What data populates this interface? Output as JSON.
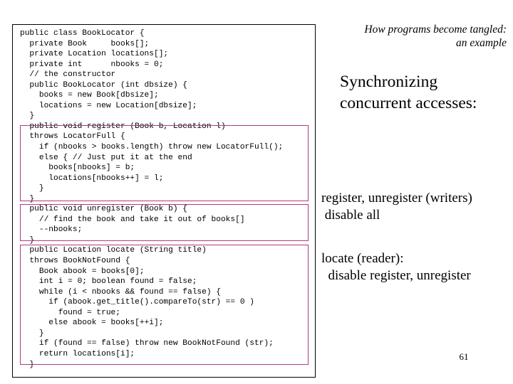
{
  "slide": {
    "title_lines": [
      "How programs become tangled:",
      "an example"
    ],
    "headline_lines": [
      "Synchronizing",
      "concurrent accesses:"
    ],
    "page_number": "61",
    "accent_color": "#b23a82",
    "frame_color": "#000000"
  },
  "code": {
    "language": "java",
    "lines": [
      "public class BookLocator {",
      "  private Book     books[];",
      "  private Location locations[];",
      "  private int      nbooks = 0;",
      "  // the constructor",
      "  public BookLocator (int dbsize) {",
      "    books = new Book[dbsize];",
      "    locations = new Location[dbsize];",
      "  }",
      "  public void register (Book b, Location l)",
      "  throws LocatorFull {",
      "    if (nbooks > books.length) throw new LocatorFull();",
      "    else { // Just put it at the end",
      "      books[nbooks] = b;",
      "      locations[nbooks++] = l;",
      "    }",
      "  }",
      "  public void unregister (Book b) {",
      "    // find the book and take it out of books[]",
      "    --nbooks;",
      "  }",
      "  public Location locate (String title)",
      "  throws BookNotFound {",
      "    Book abook = books[0];",
      "    int i = 0; boolean found = false;",
      "    while (i < nbooks && found == false) {",
      "      if (abook.get_title().compareTo(str) == 0 )",
      "        found = true;",
      "      else abook = books[++i];",
      "    }",
      "    if (found == false) throw new BookNotFound (str);",
      "    return locations[i];",
      "  }",
      "}"
    ]
  },
  "highlights": [
    {
      "id": "register-block",
      "label": "register-method-highlight"
    },
    {
      "id": "unregister-block",
      "label": "unregister-method-highlight"
    },
    {
      "id": "locate-block",
      "label": "locate-method-highlight"
    }
  ],
  "notes": {
    "writers": "register, unregister (writers)\n disable all",
    "reader": "locate (reader):\n  disable register, unregister"
  }
}
